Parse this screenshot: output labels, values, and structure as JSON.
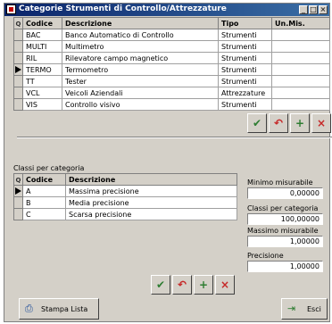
{
  "window": {
    "title": "Categorie Strumenti di Controllo/Attrezzature",
    "controls": [
      "_",
      "□",
      "×"
    ]
  },
  "categories": {
    "columns": [
      "Codice",
      "Descrizione",
      "Tipo",
      "Un.Mis."
    ],
    "rows": [
      {
        "codice": "BAC",
        "descrizione": "Banco Automatico di Controllo",
        "tipo": "Strumenti",
        "unmis": ""
      },
      {
        "codice": "MULTI",
        "descrizione": "Multimetro",
        "tipo": "Strumenti",
        "unmis": ""
      },
      {
        "codice": "RIL",
        "descrizione": "Rilevatore campo magnetico",
        "tipo": "Strumenti",
        "unmis": ""
      },
      {
        "codice": "TERMO",
        "descrizione": "Termometro",
        "tipo": "Strumenti",
        "unmis": ""
      },
      {
        "codice": "TT",
        "descrizione": "Tester",
        "tipo": "Strumenti",
        "unmis": ""
      },
      {
        "codice": "VCL",
        "descrizione": "Veicoli Aziendali",
        "tipo": "Attrezzature",
        "unmis": ""
      },
      {
        "codice": "VIS",
        "descrizione": "Controllo visivo",
        "tipo": "Strumenti",
        "unmis": ""
      }
    ],
    "selected_index": 3
  },
  "classes": {
    "section_label": "Classi per categoria",
    "columns": [
      "Codice",
      "Descrizione"
    ],
    "rows": [
      {
        "codice": "A",
        "descrizione": "Massima precisione"
      },
      {
        "codice": "B",
        "descrizione": "Media precisione"
      },
      {
        "codice": "C",
        "descrizione": "Scarsa precisione"
      }
    ],
    "selected_index": 0
  },
  "fields": {
    "minimo_label": "Minimo misurabile",
    "minimo_value": "0,00000",
    "classi_label": "Classi per categoria",
    "classi_value": "100,00000",
    "massimo_label": "Massimo misurabile",
    "massimo_value": "1,00000",
    "precisione_label": "Precisione",
    "precisione_value": "1,00000"
  },
  "buttons": {
    "stampa_label": "Stampa Lista",
    "esci_label": "Esci"
  },
  "icons": {
    "confirm": "check-icon",
    "undo": "undo-icon",
    "add": "add-icon",
    "delete": "delete-icon",
    "filter": "filter-icon",
    "printer": "printer-icon",
    "exit": "exit-icon"
  }
}
